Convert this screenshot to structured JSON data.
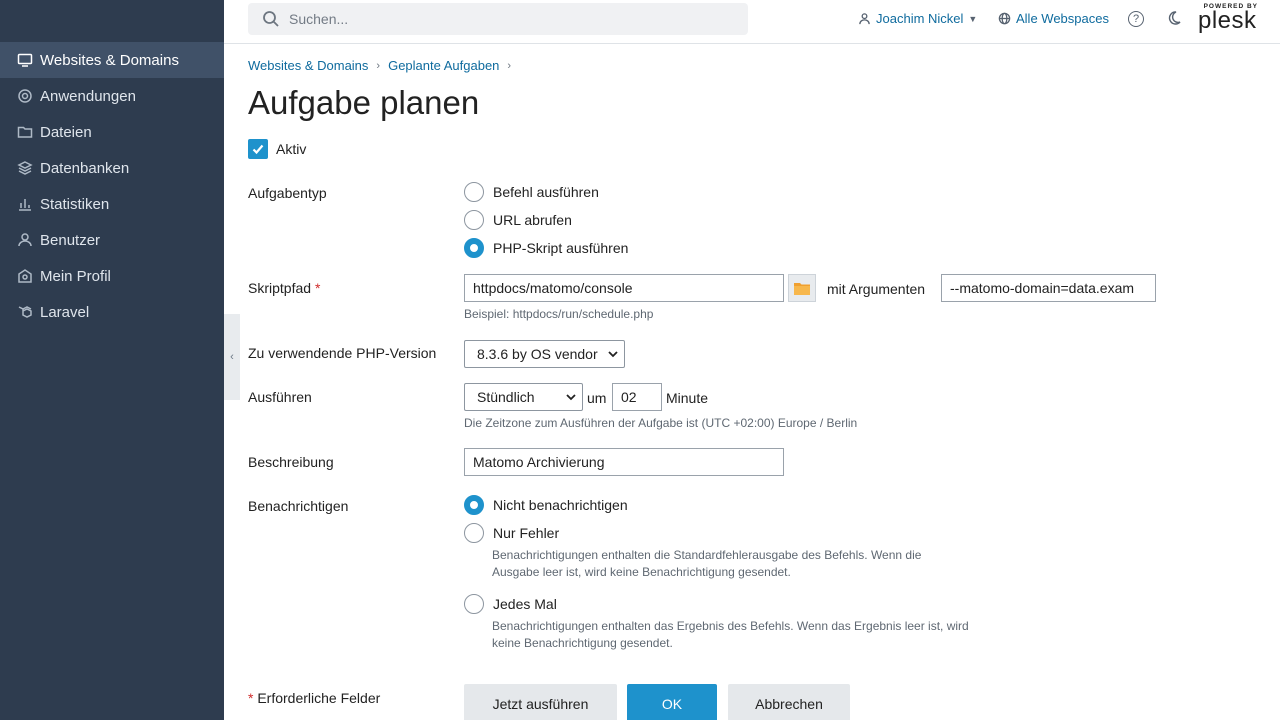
{
  "sidebar": {
    "items": [
      {
        "label": "Websites & Domains",
        "icon": "monitor-icon",
        "active": true
      },
      {
        "label": "Anwendungen",
        "icon": "gear-icon"
      },
      {
        "label": "Dateien",
        "icon": "folder-icon"
      },
      {
        "label": "Datenbanken",
        "icon": "database-icon"
      },
      {
        "label": "Statistiken",
        "icon": "bar-chart-icon"
      },
      {
        "label": "Benutzer",
        "icon": "user-icon"
      },
      {
        "label": "Mein Profil",
        "icon": "profile-icon"
      },
      {
        "label": "Laravel",
        "icon": "laravel-icon"
      }
    ]
  },
  "topbar": {
    "search_placeholder": "Suchen...",
    "user_name": "Joachim Nickel",
    "webspaces": "Alle Webspaces",
    "help": "?",
    "logo_top": "POWERED BY",
    "logo": "plesk"
  },
  "breadcrumb": [
    "Websites & Domains",
    "Geplante Aufgaben"
  ],
  "page_title": "Aufgabe planen",
  "form": {
    "active_label": "Aktiv",
    "active_checked": true,
    "task_type": {
      "label": "Aufgabentyp",
      "options": [
        "Befehl ausführen",
        "URL abrufen",
        "PHP-Skript ausführen"
      ],
      "selected": "PHP-Skript ausführen"
    },
    "script_path": {
      "label": "Skriptpfad",
      "required_mark": "*",
      "value": "httpdocs/matomo/console",
      "example": "Beispiel: httpdocs/run/schedule.php",
      "args_label": "mit Argumenten",
      "args_value": "--matomo-domain=data.exam"
    },
    "php_version": {
      "label": "Zu verwendende PHP-Version",
      "value": "8.3.6 by OS vendor"
    },
    "run": {
      "label": "Ausführen",
      "frequency": "Stündlich",
      "at_label": "um",
      "minute_value": "02",
      "minute_label": "Minute",
      "timezone_hint": "Die Zeitzone zum Ausführen der Aufgabe ist (UTC +02:00) Europe / Berlin"
    },
    "description": {
      "label": "Beschreibung",
      "value": "Matomo Archivierung"
    },
    "notify": {
      "label": "Benachrichtigen",
      "options": [
        {
          "label": "Nicht benachrichtigen",
          "hint": ""
        },
        {
          "label": "Nur Fehler",
          "hint_line1": "Benachrichtigungen enthalten die Standardfehlerausgabe des Befehls. Wenn die",
          "hint_line2": "Ausgabe leer ist, wird keine Benachrichtigung gesendet."
        },
        {
          "label": "Jedes Mal",
          "hint_line1": "Benachrichtigungen enthalten das Ergebnis des Befehls. Wenn das Ergebnis leer ist, wird",
          "hint_line2": "keine Benachrichtigung gesendet."
        }
      ],
      "selected": "Nicht benachrichtigen"
    },
    "required_note_mark": "*",
    "required_note": "Erforderliche Felder",
    "buttons": {
      "run_now": "Jetzt ausführen",
      "ok": "OK",
      "cancel": "Abbrechen"
    }
  },
  "colors": {
    "sidebar_bg": "#2e3c4f",
    "sidebar_active": "#405168",
    "accent": "#1e92cc",
    "link": "#0f6b9e"
  }
}
